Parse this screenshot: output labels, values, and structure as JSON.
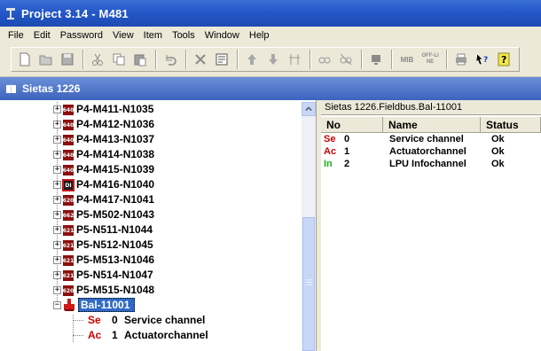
{
  "window": {
    "title": "Project 3.14 - M481"
  },
  "menu": [
    "File",
    "Edit",
    "Password",
    "View",
    "Item",
    "Tools",
    "Window",
    "Help"
  ],
  "toolbar": {
    "buttons": [
      "new-icon",
      "open-icon",
      "save-icon",
      "cut-icon",
      "copy-icon",
      "paste-icon",
      "undo-icon",
      "delete-icon",
      "properties-icon",
      "upload-icon",
      "download-icon",
      "compare-icon",
      "online-icon",
      "offline-icon",
      "monitor-icon",
      "mib-icon",
      "off-line-icon",
      "print-icon",
      "context-help-icon",
      "help-icon"
    ],
    "mib_label": "MIB",
    "offline_label": "OFF-LINE"
  },
  "panel": {
    "title": "Sietas 1226"
  },
  "tree": {
    "items": [
      {
        "badge": "640",
        "label": "P4-M411-N1035"
      },
      {
        "badge": "640",
        "label": "P4-M412-N1036"
      },
      {
        "badge": "640",
        "label": "P4-M413-N1037"
      },
      {
        "badge": "640",
        "label": "P4-M414-N1038"
      },
      {
        "badge": "640",
        "label": "P4-M415-N1039"
      },
      {
        "badge": "DI",
        "label": "P4-M416-N1040"
      },
      {
        "badge": "620",
        "label": "P4-M417-N1041"
      },
      {
        "badge": "662",
        "label": "P5-M502-N1043"
      },
      {
        "badge": "621",
        "label": "P5-N511-N1044"
      },
      {
        "badge": "621",
        "label": "P5-N512-N1045"
      },
      {
        "badge": "621",
        "label": "P5-M513-N1046"
      },
      {
        "badge": "621",
        "label": "P5-N514-N1047"
      },
      {
        "badge": "620",
        "label": "P5-M515-N1048"
      }
    ],
    "selected": {
      "label": "Bal-11001"
    },
    "children": [
      {
        "prefix": "Se",
        "no": "0",
        "label": "Service channel",
        "color": "#cc0000"
      },
      {
        "prefix": "Ac",
        "no": "1",
        "label": "Actuatorchannel",
        "color": "#cc0000"
      }
    ]
  },
  "detail": {
    "path": "Sietas 1226.Fieldbus.Bal-11001",
    "columns": [
      "No",
      "Name",
      "Status"
    ],
    "rows": [
      {
        "prefix": "Se",
        "prefix_color": "#cc0000",
        "no": "0",
        "name": "Service channel",
        "status": "Ok"
      },
      {
        "prefix": "Ac",
        "prefix_color": "#cc0000",
        "no": "1",
        "name": "Actuatorchannel",
        "status": "Ok"
      },
      {
        "prefix": "In",
        "prefix_color": "#22aa22",
        "no": "2",
        "name": "LPU Infochannel",
        "status": "Ok"
      }
    ]
  },
  "colors": {
    "titlebar": "#2458c8",
    "panel_header": "#3c64be",
    "chrome": "#ece9d8",
    "selection": "#316ac5"
  }
}
